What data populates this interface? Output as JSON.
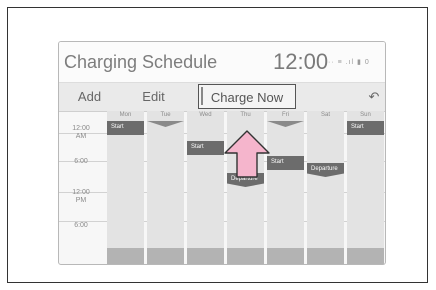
{
  "header": {
    "title": "Charging Schedule",
    "clock": "12:00",
    "status_icons": "·· ≡ .ıl ▮ 0"
  },
  "toolbar": {
    "add_label": "Add",
    "edit_label": "Edit",
    "charge_now_label": "Charge Now",
    "back_label": "↶"
  },
  "schedule": {
    "days": [
      "Mon",
      "Tue",
      "Wed",
      "Thu",
      "Fri",
      "Sat",
      "Sun"
    ],
    "time_labels": [
      "12:00\nAM",
      "6:00",
      "12:00\nPM",
      "6:00"
    ],
    "events": [
      {
        "day": "Mon",
        "label": "Start"
      },
      {
        "day": "Wed",
        "label": "Start"
      },
      {
        "day": "Thu",
        "label": "Departure"
      },
      {
        "day": "Fri",
        "label": "Start"
      },
      {
        "day": "Sat",
        "label": "Departure"
      },
      {
        "day": "Sun",
        "label": "Start"
      }
    ]
  },
  "colors": {
    "arrow_fill": "#f5b5cc",
    "arrow_stroke": "#333333",
    "event_block": "#6c6c6c"
  },
  "icons": {
    "callout": "up-arrow-pointer-icon",
    "back": "return-icon"
  }
}
